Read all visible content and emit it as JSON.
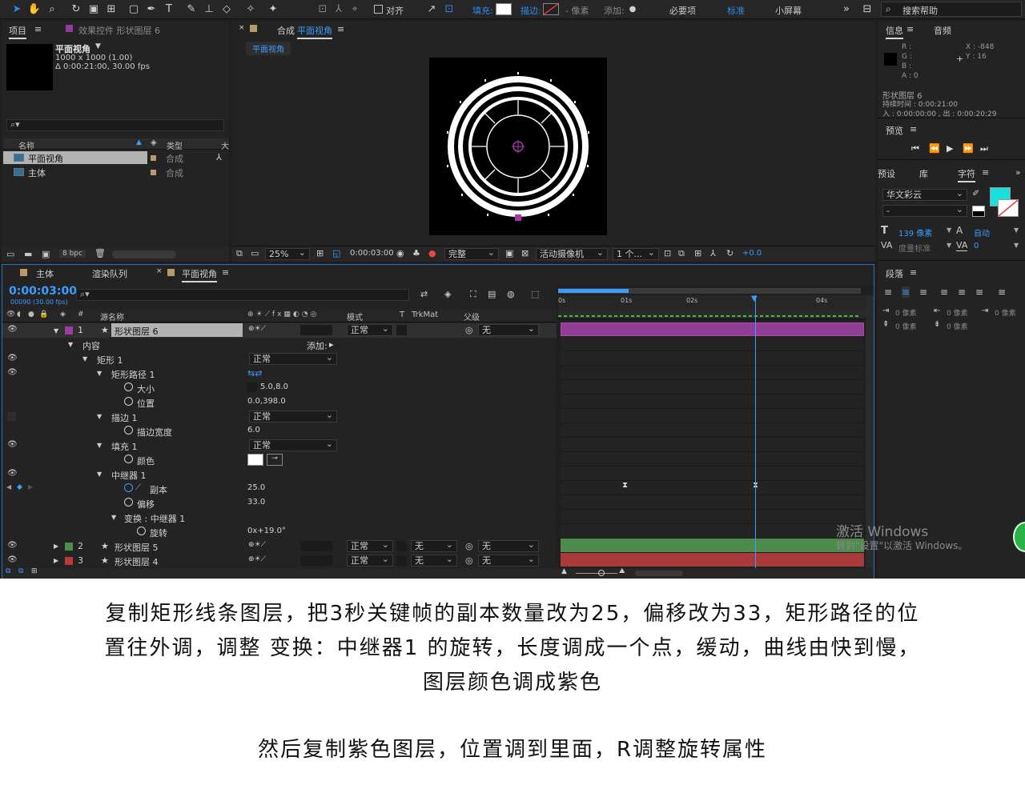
{
  "toolbar": {
    "align_label": "对齐",
    "fill_label": "填充:",
    "stroke_label": "描边:",
    "pixel_label": "- 像素",
    "add_label": "添加:",
    "workspace_essentials": "必要项",
    "workspace_standard": "标准",
    "workspace_small": "小屏幕",
    "search_placeholder": "搜索帮助"
  },
  "project_panel": {
    "tab_project": "项目",
    "tab_effects": "效果控件 形状图层 6",
    "comp_name": "平面视角",
    "comp_size": "1000 x 1000 (1.00)",
    "comp_duration": "Δ 0:00:21:00, 30.00 fps",
    "col_name": "名称",
    "col_type": "类型",
    "col_size": "大",
    "items": [
      {
        "name": "平面视角",
        "type": "合成"
      },
      {
        "name": "主体",
        "type": "合成"
      }
    ],
    "bpc": "8 bpc"
  },
  "comp_viewer": {
    "tab_prefix": "合成",
    "tab_name": "平面视角",
    "sub_tab": "平面视角",
    "zoom": "25%",
    "timecode": "0:00:03:00",
    "resolution": "完整",
    "camera": "活动摄像机",
    "views": "1 个...",
    "exposure": "+0.0"
  },
  "info_panel": {
    "tab_info": "信息",
    "tab_audio": "音频",
    "r": "R :",
    "g": "G :",
    "b": "B :",
    "a": "A : 0",
    "x": "X : -848",
    "y": "Y : 16",
    "layer_name": "形状图层 6",
    "duration": "持续时间 : 0:00:21:00",
    "in_out": "入 : 0:00:00:00 , 出 : 0:00:20:29"
  },
  "preview_panel": {
    "title": "预览"
  },
  "character_panel": {
    "tab_presets": "预设",
    "tab_library": "库",
    "tab_character": "字符",
    "font": "华文彩云",
    "style": "-",
    "font_size": "139 像素",
    "leading": "自动",
    "tracking_label": "度量标准",
    "tracking_value": "0"
  },
  "paragraph_panel": {
    "title": "段落",
    "indent_left": "0 像素",
    "indent_right": "0 像素",
    "indent_first": "0 像素",
    "space_before": "0 像素",
    "space_after": "0 像素"
  },
  "timeline": {
    "tab_main": "主体",
    "tab_render": "渲染队列",
    "tab_comp": "平面视角",
    "timecode": "0:00:03:00",
    "frame_info": "00090 (30.00 fps)",
    "col_source": "源名称",
    "col_mode": "模式",
    "col_t": "T",
    "col_trkmat": "TrkMat",
    "col_parent": "父级",
    "ruler": [
      "0s",
      "01s",
      "02s",
      "04s"
    ],
    "layer1": {
      "index": "1",
      "name": "形状图层 6",
      "mode": "正常",
      "parent": "无"
    },
    "contents_label": "内容",
    "add_label": "添加:",
    "rectangle_label": "矩形 1",
    "rectangle_mode": "正常",
    "rect_path_label": "矩形路径 1",
    "size_label": "大小",
    "size_value": "5.0,8.0",
    "position_label": "位置",
    "position_value": "0.0,398.0",
    "stroke_label": "描边 1",
    "stroke_mode": "正常",
    "stroke_width_label": "描边宽度",
    "stroke_width_value": "6.0",
    "fill_label": "填充 1",
    "fill_mode": "正常",
    "color_label": "颜色",
    "repeater_label": "中继器 1",
    "copies_label": "副本",
    "copies_value": "25.0",
    "offset_label": "偏移",
    "offset_value": "33.0",
    "transform_label": "变换 : 中继器 1",
    "rotation_label": "旋转",
    "rotation_value": "0x+19.0°",
    "layer2": {
      "index": "2",
      "name": "形状图层 5",
      "mode": "正常",
      "trkmat": "无",
      "parent": "无"
    },
    "layer3": {
      "index": "3",
      "name": "形状图层 4",
      "mode": "正常",
      "trkmat": "无",
      "parent": "无"
    }
  },
  "watermark": {
    "line1": "激活 Windows",
    "line2": "转到\"设置\"以激活 Windows。"
  },
  "captions": {
    "line1": "复制矩形线条图层，把3秒关键帧的副本数量改为25，偏移改为33，矩形路径的位",
    "line2": "置往外调，调整 变换：中继器1 的旋转，长度调成一个点，缓动，曲线由快到慢，",
    "line3": "图层颜色调成紫色",
    "line4": "然后复制紫色图层，位置调到里面，R调整旋转属性"
  },
  "colors": {
    "accent_blue": "#2d8ceb",
    "layer_purple": "#9b3f9e",
    "layer_green": "#4a8f4a",
    "layer_red": "#b83a3a",
    "swatch_cyan": "#19e0dc"
  }
}
